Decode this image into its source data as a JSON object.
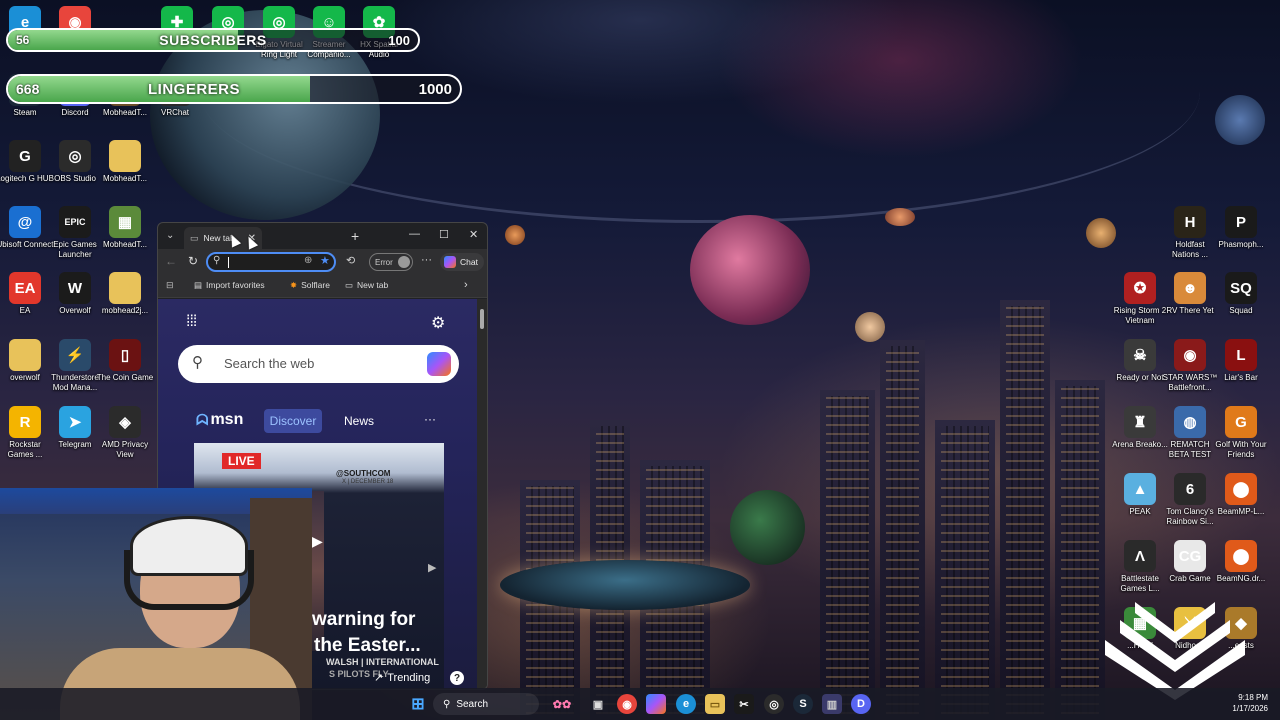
{
  "overlay": {
    "subscribers": {
      "current": "56",
      "title": "SUBSCRIBERS",
      "goal": "100",
      "progress": 0.56
    },
    "lingerers": {
      "current": "668",
      "title": "LINGERERS",
      "goal": "1000",
      "progress": 0.668
    }
  },
  "desktop_left": [
    {
      "name": "edge-icon",
      "label": "Edge",
      "color": "#1b8fd6",
      "glyph": "e"
    },
    {
      "name": "chrome-icon",
      "label": "Chrome",
      "color": "#e8453c",
      "glyph": "◉"
    },
    {
      "name": "steam-icon",
      "label": "Steam",
      "color": "#1b2838",
      "glyph": "S"
    },
    {
      "name": "discord-icon",
      "label": "Discord",
      "color": "#5865f2",
      "glyph": "D"
    },
    {
      "name": "mobhead-icon-1",
      "label": "MobheadT...",
      "color": "#6b4f2a",
      "glyph": "▦"
    },
    {
      "name": "vrchat-icon",
      "label": "VRChat",
      "color": "#2b2b2b",
      "glyph": "V"
    },
    {
      "name": "logitech-icon",
      "label": "Logitech G HUB",
      "color": "#222222",
      "glyph": "G"
    },
    {
      "name": "obs-icon",
      "label": "OBS Studio",
      "color": "#2b2b2b",
      "glyph": "◎"
    },
    {
      "name": "folder-icon-1",
      "label": "MobheadT...",
      "color": "#e8c25a",
      "glyph": ""
    },
    {
      "name": "ubisoft-icon",
      "label": "Ubisoft Connect",
      "color": "#1a6fd1",
      "glyph": "@"
    },
    {
      "name": "epic-icon",
      "label": "Epic Games Launcher",
      "color": "#1b1b1b",
      "glyph": "EPIC"
    },
    {
      "name": "minecraft-icon",
      "label": "MobheadT...",
      "color": "#5b8a3a",
      "glyph": "▦"
    },
    {
      "name": "ea-icon",
      "label": "EA",
      "color": "#e2372b",
      "glyph": "EA"
    },
    {
      "name": "overwolf-icon",
      "label": "Overwolf",
      "color": "#1b1b1b",
      "glyph": "W"
    },
    {
      "name": "folder-icon-2",
      "label": "mobhead2j...",
      "color": "#e8c25a",
      "glyph": ""
    },
    {
      "name": "folder-icon-3",
      "label": "overwolf",
      "color": "#e8c25a",
      "glyph": ""
    },
    {
      "name": "thunderstore-icon",
      "label": "Thunderstore Mod Mana...",
      "color": "#2a4a6a",
      "glyph": "⚡"
    },
    {
      "name": "coin-game-icon",
      "label": "The Coin Game",
      "color": "#6b1212",
      "glyph": "▯"
    },
    {
      "name": "rockstar-icon",
      "label": "Rockstar Games ...",
      "color": "#f4b400",
      "glyph": "R"
    },
    {
      "name": "telegram-icon",
      "label": "Telegram",
      "color": "#2aa3e0",
      "glyph": "➤"
    },
    {
      "name": "amd-privacy-icon",
      "label": "AMD Privacy View",
      "color": "#2b2b2b",
      "glyph": "◈"
    }
  ],
  "desktop_top": [
    {
      "name": "green-app-icon-1",
      "label": "",
      "color": "#14b84a",
      "glyph": "✚"
    },
    {
      "name": "green-app-icon-2",
      "label": "",
      "color": "#14b84a",
      "glyph": "◎"
    },
    {
      "name": "ring-light-icon",
      "label": "Elgato Virtual Ring Light",
      "color": "#14b84a",
      "glyph": "◎"
    },
    {
      "name": "streamer-icon",
      "label": "Streamer Companio...",
      "color": "#14b84a",
      "glyph": "☺"
    },
    {
      "name": "hx-spatial-icon",
      "label": "HX Spatial Audio",
      "color": "#14b84a",
      "glyph": "✿"
    }
  ],
  "desktop_right": [
    {
      "name": "holdfast-icon",
      "label": "Holdfast Nations ...",
      "color": "#2a2418",
      "glyph": "H"
    },
    {
      "name": "phasmophobia-icon",
      "label": "Phasmoph...",
      "color": "#1a1a1a",
      "glyph": "P"
    },
    {
      "name": "rising-storm-icon",
      "label": "Rising Storm 2 Vietnam",
      "color": "#b02020",
      "glyph": "✪"
    },
    {
      "name": "rv-there-yet-icon",
      "label": "RV There Yet",
      "color": "#d98a3a",
      "glyph": "☻"
    },
    {
      "name": "squad-icon",
      "label": "Squad",
      "color": "#1a1a1a",
      "glyph": "SQ"
    },
    {
      "name": "ready-or-not-icon",
      "label": "Ready or Not",
      "color": "#3a3a3a",
      "glyph": "☠"
    },
    {
      "name": "star-wars-icon",
      "label": "STAR WARS™ Battlefront...",
      "color": "#8a1a1a",
      "glyph": "◉"
    },
    {
      "name": "liars-bar-icon",
      "label": "Liar's Bar",
      "color": "#8a1010",
      "glyph": "L"
    },
    {
      "name": "arena-breakout-icon",
      "label": "Arena Breako...",
      "color": "#3a3a3a",
      "glyph": "♜"
    },
    {
      "name": "rematch-icon",
      "label": "REMATCH BETA TEST",
      "color": "#3a6aaa",
      "glyph": "◍"
    },
    {
      "name": "golf-friends-icon",
      "label": "Golf With Your Friends",
      "color": "#e07a1a",
      "glyph": "G"
    },
    {
      "name": "peak-icon",
      "label": "PEAK",
      "color": "#5ab0e0",
      "glyph": "▲"
    },
    {
      "name": "rainbow-six-icon",
      "label": "Tom Clancy's Rainbow Si...",
      "color": "#2a2a2a",
      "glyph": "6"
    },
    {
      "name": "beammp-icon",
      "label": "BeamMP-L...",
      "color": "#e05a1a",
      "glyph": "⬤"
    },
    {
      "name": "battlestate-icon",
      "label": "Battlestate Games L...",
      "color": "#2a2a2a",
      "glyph": "Λ"
    },
    {
      "name": "crab-game-icon",
      "label": "Crab Game",
      "color": "#e8e8e8",
      "glyph": "CG"
    },
    {
      "name": "beamng-icon",
      "label": "BeamNG.dr...",
      "color": "#e05a1a",
      "glyph": "⬤"
    },
    {
      "name": "head-icon",
      "label": "...Head",
      "color": "#3a8a3a",
      "glyph": "▦"
    },
    {
      "name": "nidhogg-icon",
      "label": "Nidhogg",
      "color": "#e8c040",
      "glyph": "⚔"
    },
    {
      "name": "beasts-icon",
      "label": "...easts",
      "color": "#aa7a2a",
      "glyph": "◆"
    }
  ],
  "browser": {
    "tab_label": "New tab",
    "error_label": "Error",
    "chat_label": "Chat",
    "favorites": [
      {
        "label": "Import favorites"
      },
      {
        "label": "Solflare"
      },
      {
        "label": "New tab"
      }
    ],
    "search_placeholder": "Search the web",
    "msn_logo": "msn",
    "feed_tabs": [
      {
        "label": "Discover"
      },
      {
        "label": "News"
      }
    ],
    "news": {
      "live_badge": "LIVE",
      "source": "@SOUTHCOM",
      "sub_source": "X | DECEMBER 18",
      "headline_line1": "warning for",
      "headline_line2": "the Easter...",
      "ticker": "WALSH | INTERNATIONAL",
      "ticker2": "S PILOTS FLY",
      "trending_label": "Trending"
    }
  },
  "taskbar": {
    "search_label": "Search",
    "time": "9:18 PM",
    "date": "1/17/2026"
  }
}
